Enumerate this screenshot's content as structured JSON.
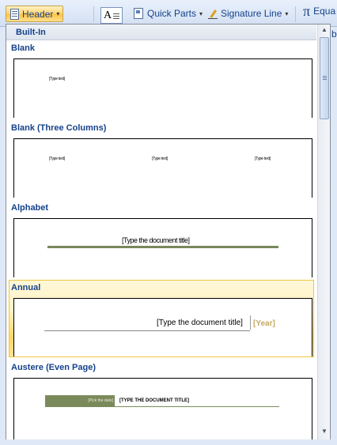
{
  "ribbon": {
    "header_label": "Header",
    "quick_parts_label": "Quick Parts",
    "signature_line_label": "Signature Line",
    "equation_label": "Equa",
    "clipped_right": "b",
    "textbox_glyph": "A",
    "pi_glyph": "π",
    "dropdown_caret": "▾"
  },
  "panel": {
    "group_header": "Built-In",
    "scroll_up": "▲",
    "scroll_down": "▼",
    "items": [
      {
        "name": "Blank",
        "placeholder": "[Type text]"
      },
      {
        "name": "Blank (Three Columns)",
        "placeholders": [
          "[Type text]",
          "[Type text]",
          "[Type text]"
        ]
      },
      {
        "name": "Alphabet",
        "title": "[Type the document title]"
      },
      {
        "name": "Annual",
        "title": "[Type the document title]",
        "year": "[Year]"
      },
      {
        "name": "Austere (Even Page)",
        "date": "[Pick the date]",
        "title": "[TYPE THE DOCUMENT TITLE]"
      }
    ]
  },
  "colors": {
    "accent_text": "#15428b",
    "selection_fill": "#ffd766",
    "alphabet_rule": "#78885b",
    "annual_year": "#c5aa63",
    "austere_bar": "#7b8a5a"
  }
}
